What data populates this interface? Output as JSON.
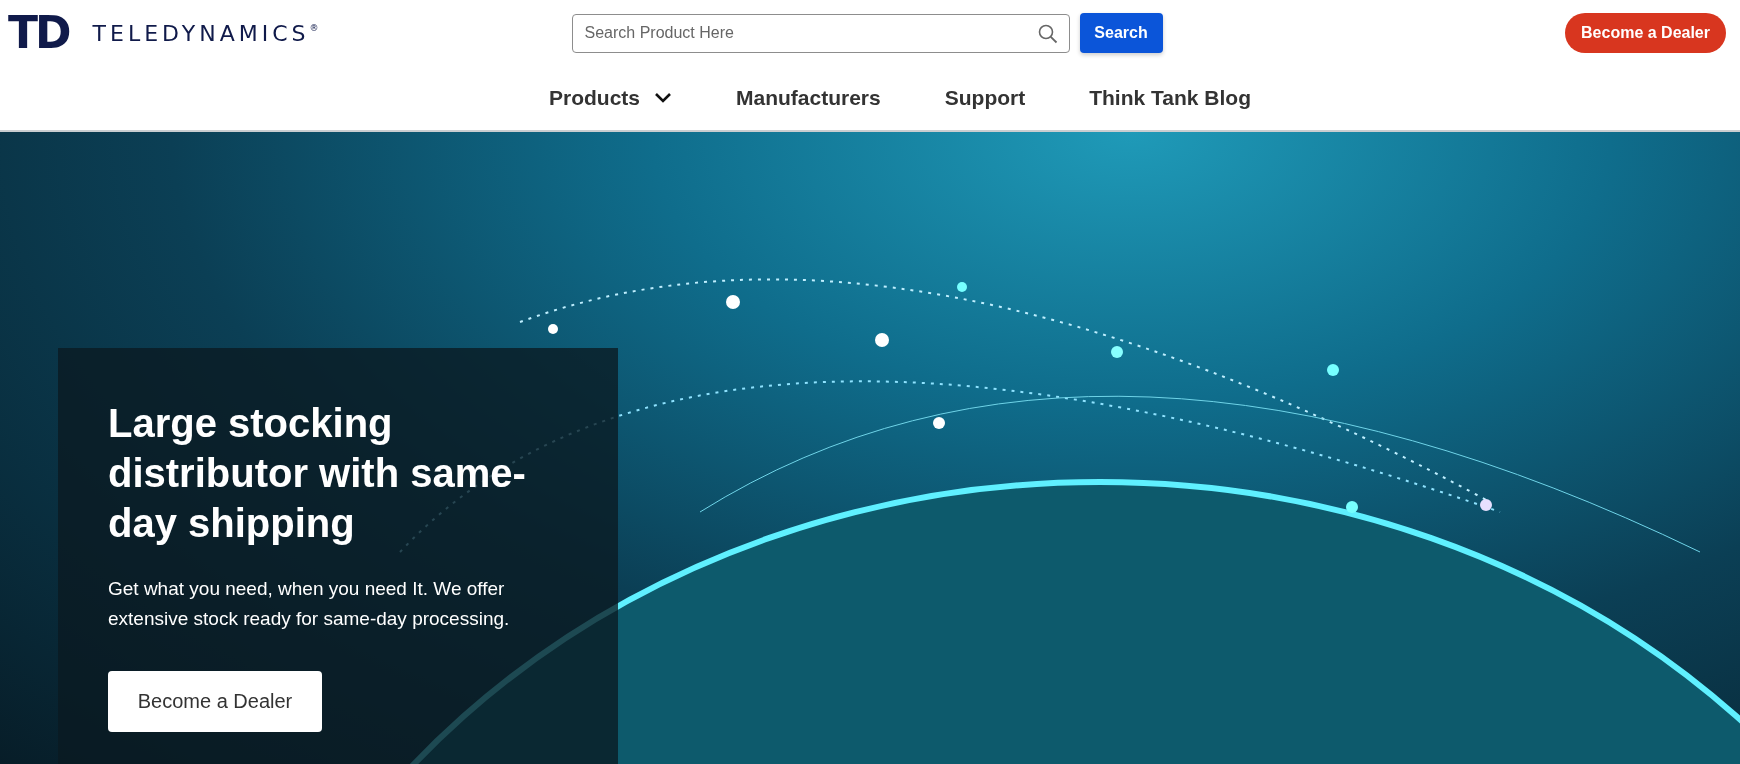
{
  "header": {
    "logo": {
      "mark": "TD",
      "name": "TELEDYNAMICS",
      "registered": "®"
    },
    "search": {
      "placeholder": "Search Product Here",
      "button": "Search"
    },
    "cta": "Become a Dealer",
    "nav": [
      {
        "label": "Products",
        "has_dropdown": true
      },
      {
        "label": "Manufacturers",
        "has_dropdown": false
      },
      {
        "label": "Support",
        "has_dropdown": false
      },
      {
        "label": "Think Tank Blog",
        "has_dropdown": false
      }
    ]
  },
  "hero": {
    "title": "Large stocking distributor with same-day shipping",
    "text": "Get what you need, when you need It. We offer extensive stock ready for same-day processing.",
    "button": "Become a Dealer"
  }
}
